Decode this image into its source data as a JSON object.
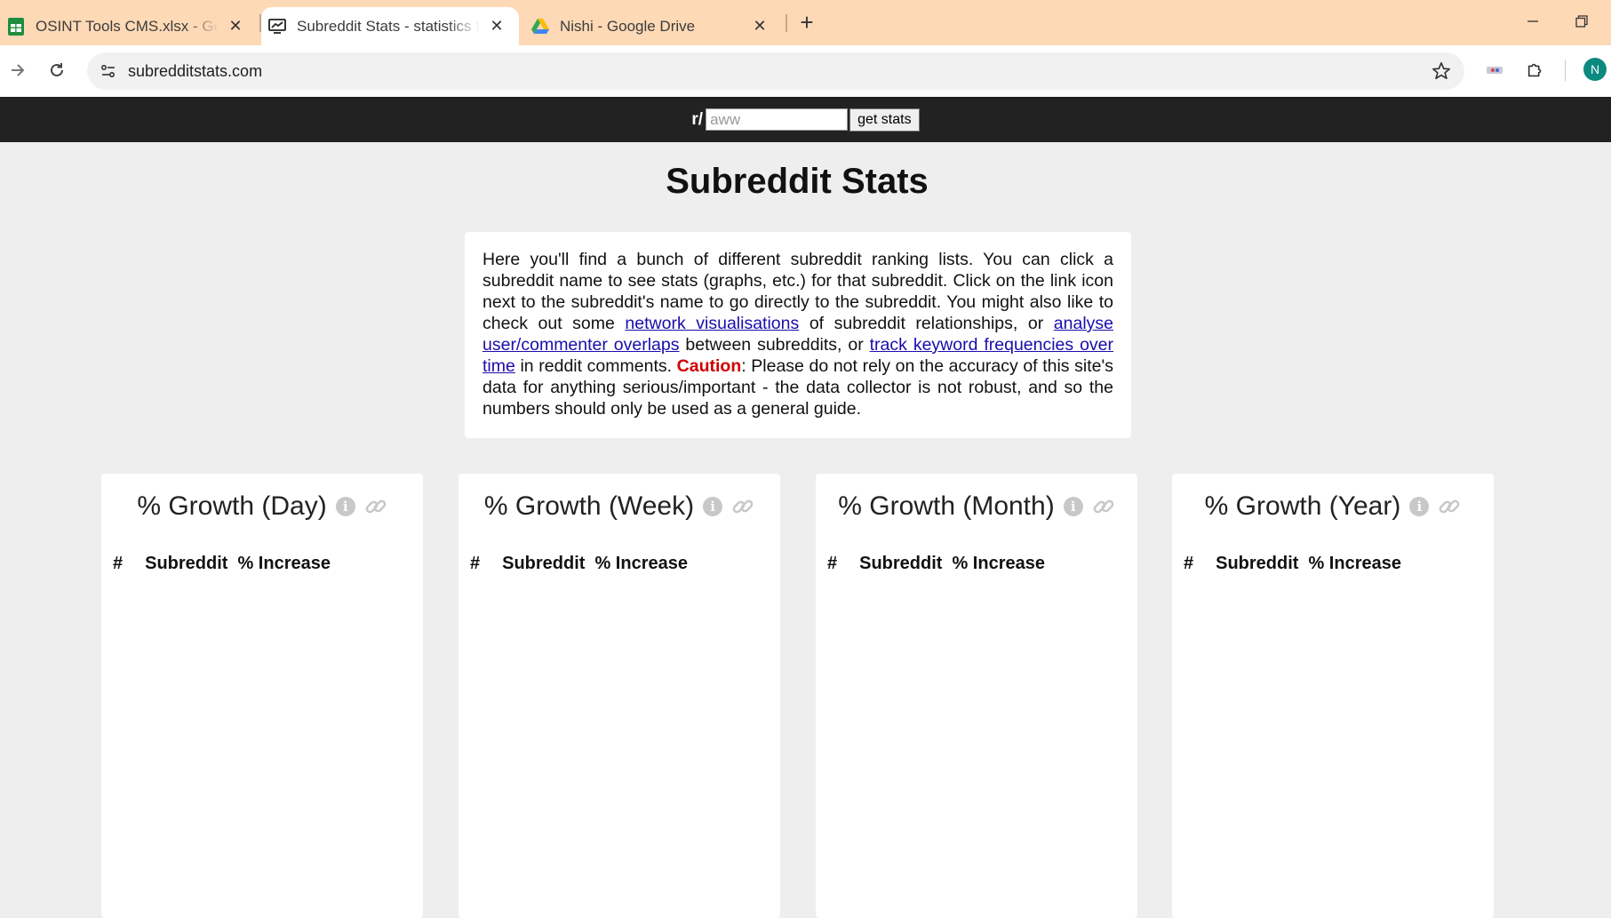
{
  "browser": {
    "tabs": [
      {
        "title": "OSINT Tools CMS.xlsx - Google",
        "icon": "sheets-icon",
        "active": false
      },
      {
        "title": "Subreddit Stats - statistics for every subreddit",
        "icon": "chart-icon",
        "active": true
      },
      {
        "title": "Nishi - Google Drive",
        "icon": "drive-icon",
        "active": false
      }
    ],
    "new_tab_label": "+",
    "url": "subredditstats.com",
    "profile_initial": "N"
  },
  "search": {
    "prefix": "r/",
    "placeholder": "aww",
    "button_label": "get stats"
  },
  "page": {
    "title": "Subreddit Stats",
    "intro": {
      "p1": "Here you'll find a bunch of different subreddit ranking lists. You can click a subreddit name to see stats (graphs, etc.) for that subreddit. Click on the link icon next to the subreddit's name to go directly to the subreddit. You might also like to check out some ",
      "link1": "network visualisations",
      "p2": " of subreddit relationships, or ",
      "link2": "analyse user/commenter overlaps",
      "p3": " between subreddits, or ",
      "link3": "track keyword frequencies over time",
      "p4": " in reddit comments. ",
      "caution_label": "Caution",
      "p5": ": Please do not rely on the accuracy of this site's data for anything serious/important - the data collector is not robust, and so the numbers should only be used as a general guide."
    }
  },
  "cards": [
    {
      "title": "% Growth (Day)",
      "columns": [
        "#",
        "Subreddit",
        "% Increase"
      ]
    },
    {
      "title": "% Growth (Week)",
      "columns": [
        "#",
        "Subreddit",
        "% Increase"
      ]
    },
    {
      "title": "% Growth (Month)",
      "columns": [
        "#",
        "Subreddit",
        "% Increase"
      ]
    },
    {
      "title": "% Growth (Year)",
      "columns": [
        "#",
        "Subreddit",
        "% Increase"
      ]
    }
  ],
  "colors": {
    "tabbar_bg": "#fdd9b6",
    "topbar_bg": "#222222",
    "page_bg": "#eeeeee",
    "link": "#1a0dab",
    "caution": "#d00000"
  }
}
